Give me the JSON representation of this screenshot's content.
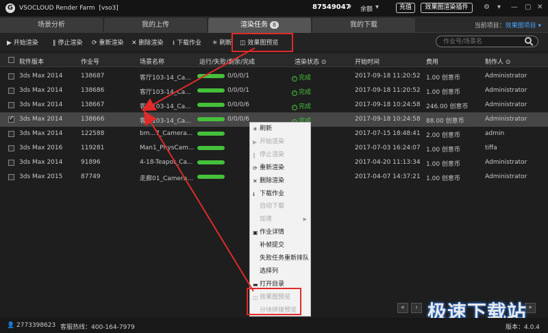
{
  "app": {
    "title": "VSOCLOUD Render Farm",
    "project_tag": "[vso3]",
    "account_id": "87549047",
    "balance_label": "余额",
    "recharge_label": "充值",
    "plugin_label": "效果图渲染插件"
  },
  "tabs": [
    {
      "label": "场景分析"
    },
    {
      "label": "我的上传"
    },
    {
      "label": "渲染任务",
      "badge": "8"
    },
    {
      "label": "我的下载"
    }
  ],
  "current_project": {
    "label": "当前项目：",
    "value": "效果图项目"
  },
  "toolbar": {
    "start": "开始渲染",
    "stop": "停止渲染",
    "rerender": "重新渲染",
    "delete": "删除渲染",
    "download": "下载作业",
    "refresh": "刷新",
    "preview": "效果图预览",
    "search_placeholder": "作业号/场景名"
  },
  "table": {
    "headers": [
      "软件版本",
      "作业号",
      "场景名称",
      "运行/失败/剩余/完成",
      "渲染状态",
      "开始时间",
      "费用",
      "制作人"
    ],
    "rows": [
      {
        "software": "3ds Max 2014",
        "job": "138687",
        "scene": "客厅103-14_Ca...",
        "progress_text": "0/0/0/1",
        "progress": 1,
        "status": "完成",
        "start": "2017-09-18 11:20:52",
        "cost": "1.00 创意币",
        "author": "Administrator",
        "checked": false,
        "selected": false
      },
      {
        "software": "3ds Max 2014",
        "job": "138686",
        "scene": "客厅103-14_Ca...",
        "progress_text": "0/0/0/1",
        "progress": 1,
        "status": "完成",
        "start": "2017-09-18 11:20:52",
        "cost": "1.00 创意币",
        "author": "Administrator",
        "checked": false,
        "selected": false
      },
      {
        "software": "3ds Max 2014",
        "job": "138667",
        "scene": "客厅103-14_Ca...",
        "progress_text": "0/0/0/6",
        "progress": 1,
        "status": "完成",
        "start": "2017-09-18 10:24:58",
        "cost": "246.00 创意币",
        "author": "Administrator",
        "checked": false,
        "selected": false
      },
      {
        "software": "3ds Max 2014",
        "job": "138666",
        "scene": "客厅103-14_Ca...",
        "progress_text": "0/0/0/6",
        "progress": 1,
        "status": "完成",
        "start": "2017-09-18 10:24:58",
        "cost": "88.00 创意币",
        "author": "Administrator",
        "checked": true,
        "selected": true
      },
      {
        "software": "3ds Max 2014",
        "job": "122588",
        "scene": "bm...7_Camera...",
        "progress_text": "",
        "progress": 1,
        "status": "",
        "start": "2017-07-15 18:48:41",
        "cost": "2.00 创意币",
        "author": "admin",
        "checked": false,
        "selected": false
      },
      {
        "software": "3ds Max 2016",
        "job": "119281",
        "scene": "Man1_PhysCam...",
        "progress_text": "",
        "progress": 1,
        "status": "",
        "start": "2017-07-03 16:24:07",
        "cost": "1.00 创意币",
        "author": "tiffa",
        "checked": false,
        "selected": false
      },
      {
        "software": "3ds Max 2014",
        "job": "91896",
        "scene": "4-18-Teapot_Ca...",
        "progress_text": "",
        "progress": 1,
        "status": "",
        "start": "2017-04-20 11:13:34",
        "cost": "1.00 创意币",
        "author": "Administrator",
        "checked": false,
        "selected": false
      },
      {
        "software": "3ds Max 2015",
        "job": "87749",
        "scene": "走廊01_Camera...",
        "progress_text": "",
        "progress": 1,
        "status": "",
        "start": "2017-04-07 14:37:21",
        "cost": "1.00 创意币",
        "author": "Administrator",
        "checked": false,
        "selected": false
      }
    ]
  },
  "context_menu": [
    {
      "label": "刷新",
      "icon": "✳",
      "disabled": false
    },
    {
      "label": "开始渲染",
      "icon": "▶",
      "disabled": true
    },
    {
      "label": "停止渲染",
      "icon": "‖",
      "disabled": true
    },
    {
      "label": "重新渲染",
      "icon": "⟳",
      "disabled": false
    },
    {
      "label": "删除渲染",
      "icon": "✕",
      "disabled": false
    },
    {
      "label": "下载作业",
      "icon": "⭳",
      "disabled": false
    },
    {
      "label": "自动下载",
      "icon": "",
      "disabled": true
    },
    {
      "label": "加速",
      "icon": "",
      "disabled": true,
      "submenu": true
    },
    {
      "label": "作业详情",
      "icon": "▣",
      "disabled": false
    },
    {
      "label": "补帧提交",
      "icon": "",
      "disabled": false
    },
    {
      "label": "失败任务重新排队",
      "icon": "",
      "disabled": false
    },
    {
      "label": "选择列",
      "icon": "",
      "disabled": false
    },
    {
      "label": "打开目录",
      "icon": "▬",
      "disabled": false
    },
    {
      "label": "效果图预览",
      "icon": "◫",
      "disabled": true
    },
    {
      "label": "分块拼接预览",
      "icon": "",
      "disabled": true
    }
  ],
  "footer": {
    "qq": "2773398623",
    "hotline": "客服热线：400-164-7979",
    "version": "版本：4.0.4"
  },
  "pager": {
    "first": "«",
    "prev": "‹",
    "next": "›",
    "last": "»"
  },
  "watermark": "极速下载站",
  "colors": {
    "accent_green": "#45c03a",
    "annotation_red": "#e12a2a",
    "link_blue": "#4aa3ff"
  }
}
